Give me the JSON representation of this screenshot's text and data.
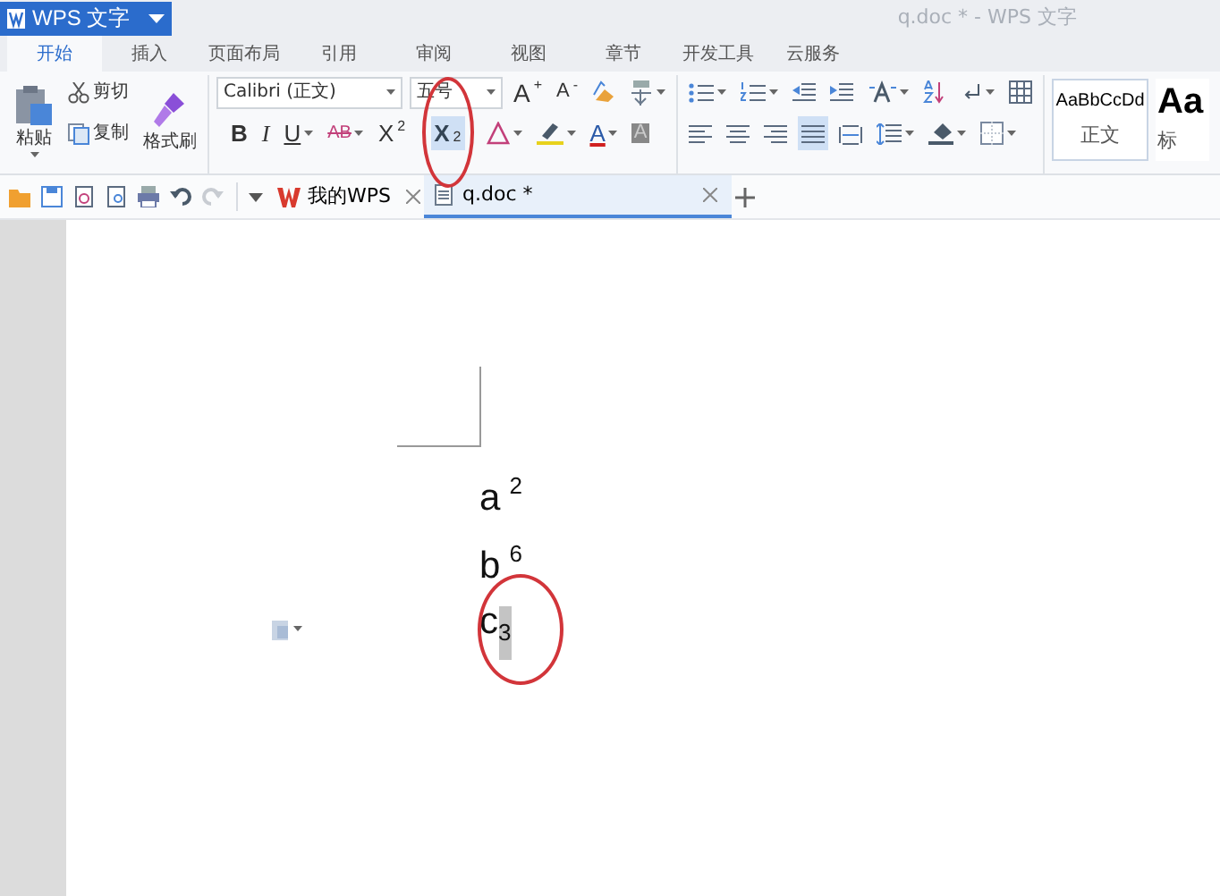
{
  "app_button": {
    "label": "WPS 文字"
  },
  "window": {
    "title": "q.doc * - WPS 文字"
  },
  "ribbon_tabs": [
    {
      "label": "开始",
      "selected": true
    },
    {
      "label": "插入",
      "selected": false
    },
    {
      "label": "页面布局",
      "selected": false
    },
    {
      "label": "引用",
      "selected": false
    },
    {
      "label": "审阅",
      "selected": false
    },
    {
      "label": "视图",
      "selected": false
    },
    {
      "label": "章节",
      "selected": false
    },
    {
      "label": "开发工具",
      "selected": false
    },
    {
      "label": "云服务",
      "selected": false
    }
  ],
  "clipboard": {
    "paste": "粘贴",
    "cut": "剪切",
    "copy": "复制",
    "format_painter": "格式刷"
  },
  "font": {
    "name": "Calibri (正文)",
    "size": "五号"
  },
  "size_buttons": [
    {
      "kind": "grow",
      "label": "A",
      "script": "+"
    },
    {
      "kind": "shrink",
      "label": "A",
      "script": "-"
    }
  ],
  "format_buttons": [
    {
      "kind": "bold",
      "label": "B",
      "active": false
    },
    {
      "kind": "italic",
      "label": "I",
      "active": false
    },
    {
      "kind": "underline",
      "label": "U",
      "active": false
    },
    {
      "kind": "strikethrough",
      "label": "AB",
      "active": false
    },
    {
      "kind": "superscript",
      "label": "X",
      "script": "2",
      "active": false
    },
    {
      "kind": "subscript",
      "label": "X",
      "script": "2",
      "active": true
    },
    {
      "kind": "fontcolor",
      "label": "A",
      "active": false
    },
    {
      "kind": "shading",
      "label": "A",
      "active": false
    }
  ],
  "align_buttons": [
    {
      "kind": "left",
      "active": false
    },
    {
      "kind": "center",
      "active": false
    },
    {
      "kind": "right",
      "active": false
    },
    {
      "kind": "justify",
      "active": true
    },
    {
      "kind": "distributed",
      "active": false
    }
  ],
  "styles": [
    {
      "preview": "AaBbCcDd",
      "name": "正文",
      "selected": true
    },
    {
      "preview": "Aa",
      "name": "标",
      "selected": false
    }
  ],
  "doc_tabs": [
    {
      "kind": "home",
      "label": "我的WPS",
      "selected": false
    },
    {
      "kind": "doc",
      "label": "q.doc *",
      "selected": true
    }
  ],
  "document_lines": [
    {
      "base": "a",
      "script": "2",
      "kind": "superscript",
      "selected": false
    },
    {
      "base": "b",
      "script": "6",
      "kind": "superscript",
      "selected": false
    },
    {
      "base": "c",
      "script": "3",
      "kind": "subscript",
      "selected": true
    }
  ],
  "callouts": {
    "subscript_button": true,
    "subscript_text": true
  }
}
